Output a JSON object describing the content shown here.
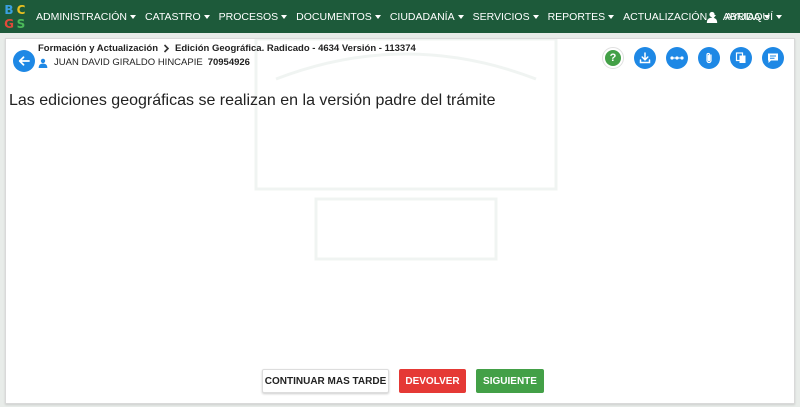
{
  "logo": {
    "letters": [
      "B",
      "C",
      "G",
      "S"
    ],
    "colors": [
      "#3aa0e0",
      "#e8c020",
      "#e04a3a",
      "#4cba5a"
    ]
  },
  "nav": {
    "items": [
      {
        "label": "ADMINISTRACIÓN"
      },
      {
        "label": "CATASTRO"
      },
      {
        "label": "PROCESOS"
      },
      {
        "label": "DOCUMENTOS"
      },
      {
        "label": "CIUDADANÍA"
      },
      {
        "label": "SERVICIOS"
      },
      {
        "label": "REPORTES"
      },
      {
        "label": "ACTUALIZACIÓN"
      },
      {
        "label": "AYUDA"
      }
    ],
    "user": "ABRIAQUÍ"
  },
  "header": {
    "breadcrumb_parent": "Formación y Actualización",
    "breadcrumb_current": "Edición Geográfica. Radicado - 4634 Versión - 113374",
    "person_name": "JUAN DAVID GIRALDO HINCAPIE",
    "person_id": "70954926"
  },
  "actions": [
    "help-icon",
    "download-icon",
    "more-icon",
    "attachment-icon",
    "copy-icon",
    "comment-icon"
  ],
  "main": {
    "message": "Las ediciones geográficas se realizan en la versión padre del trámite"
  },
  "footer": {
    "later_label": "CONTINUAR MAS TARDE",
    "return_label": "DEVOLVER",
    "next_label": "SIGUIENTE"
  },
  "colors": {
    "navbar": "#1d5a3a",
    "accent_blue": "#1e88e5",
    "danger": "#e53935",
    "success": "#43a047"
  }
}
